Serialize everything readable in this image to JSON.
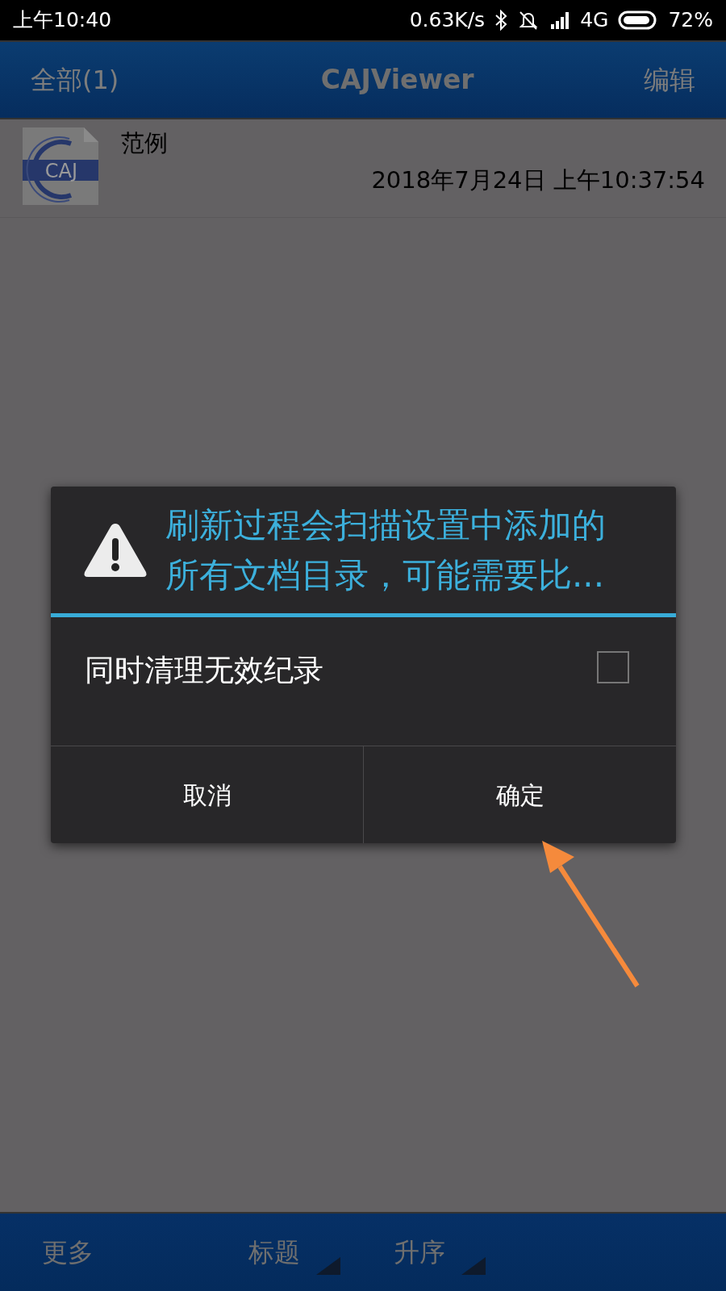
{
  "status_bar": {
    "time": "上午10:40",
    "net_speed": "0.63K/s",
    "network": "4G",
    "battery": "72%"
  },
  "header": {
    "left": "全部(1)",
    "title": "CAJViewer",
    "right": "编辑"
  },
  "files": [
    {
      "icon_label": "CAJ",
      "name": "范例",
      "date": "2018年7月24日 上午10:37:54"
    }
  ],
  "dialog": {
    "message": "刷新过程会扫描设置中添加的所有文档目录，可能需要比...",
    "option": {
      "label": "同时清理无效纪录",
      "checked": false
    },
    "buttons": [
      "取消",
      "确定"
    ]
  },
  "bottom_bar": [
    {
      "label": "更多",
      "kind": "plain"
    },
    {
      "label": "标题",
      "kind": "sort"
    },
    {
      "label": "升序",
      "kind": "sort"
    }
  ]
}
